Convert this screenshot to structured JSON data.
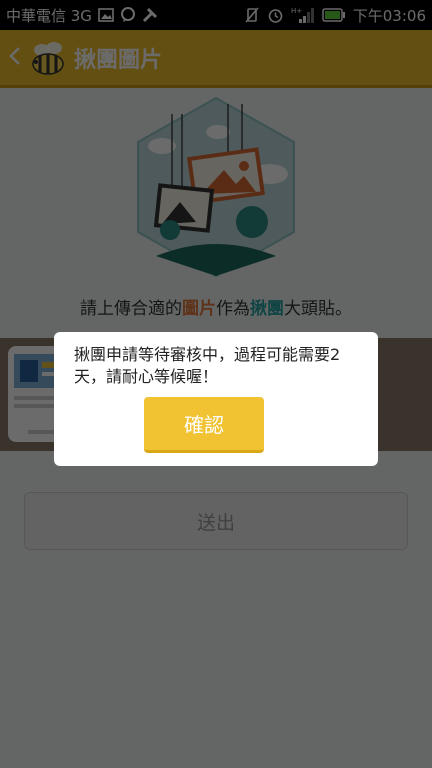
{
  "status_bar": {
    "carrier": "中華電信 3G",
    "time": "下午03:06",
    "network_label": "H+"
  },
  "app_bar": {
    "back_icon": "chevron-left-icon",
    "title": "揪團圖片"
  },
  "hint": {
    "part1": "請上傳合適的",
    "part2": "圖片",
    "part3": "作為",
    "part4": "揪團",
    "part5": "大頭貼。"
  },
  "submit_button": {
    "label": "送出"
  },
  "dialog": {
    "message": "揪團申請等待審核中，過程可能需要2天，請耐心等候喔！",
    "confirm_label": "確認"
  },
  "colors": {
    "accent": "#ebbd2a",
    "highlight_red": "#e07a3c",
    "highlight_teal": "#2aa4a2"
  }
}
